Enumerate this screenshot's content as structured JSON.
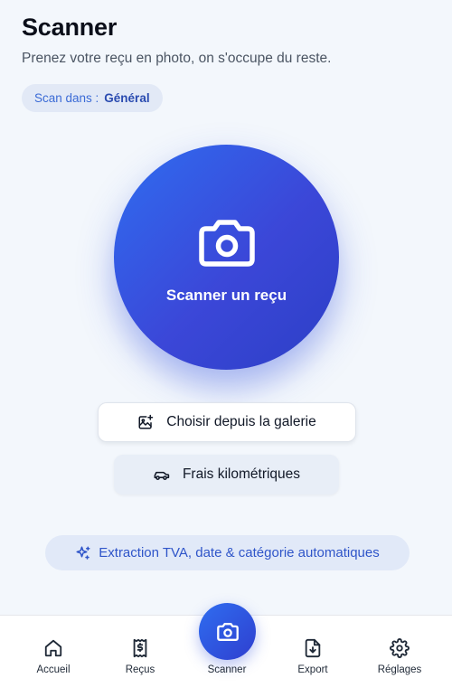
{
  "header": {
    "title": "Scanner",
    "subtitle": "Prenez votre reçu en photo, on s'occupe du reste."
  },
  "scope": {
    "label": "Scan dans :",
    "value": "Général"
  },
  "scan": {
    "label": "Scanner un reçu",
    "icon": "camera-icon"
  },
  "actions": {
    "gallery_label": "Choisir depuis la galerie",
    "gallery_icon": "image-plus-icon",
    "mileage_label": "Frais kilométriques",
    "mileage_icon": "car-icon"
  },
  "ai_hint": {
    "label": "Extraction TVA, date & catégorie automatiques",
    "icon": "sparkles-icon"
  },
  "nav": {
    "items": [
      {
        "label": "Accueil",
        "icon": "home-icon"
      },
      {
        "label": "Reçus",
        "icon": "receipt-icon"
      },
      {
        "label": "Scanner",
        "icon": "camera-icon"
      },
      {
        "label": "Export",
        "icon": "download-icon"
      },
      {
        "label": "Réglages",
        "icon": "gear-icon"
      }
    ]
  },
  "colors": {
    "accent": "#2f55c9",
    "background": "#f3f7fc"
  }
}
